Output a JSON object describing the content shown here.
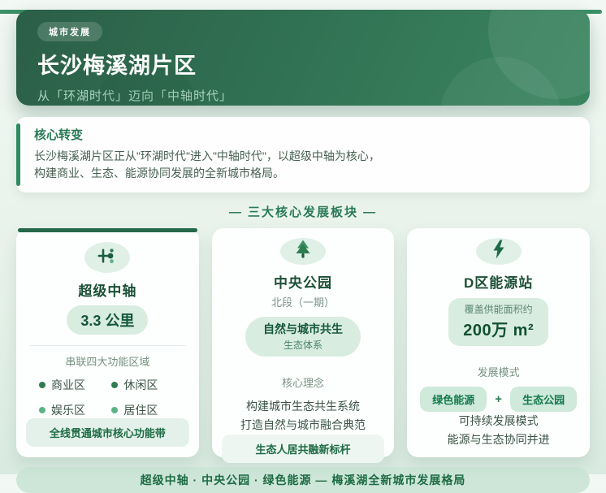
{
  "colors": {
    "accent_dark": "#1d5c40",
    "accent": "#2e7d52",
    "accent_light": "#5cb385",
    "header_gradient_start": "#2b5f47",
    "header_gradient_end": "#3a8560",
    "topbar": "#3c9168",
    "pill_bg": "#d9ece0",
    "footer_bg": "#cde6d8",
    "page_bg": "#e7f2ea"
  },
  "icons": {
    "card1": "axis-icon",
    "card2": "tree-icon",
    "card3": "bolt-icon"
  },
  "header": {
    "badge": "城市发展",
    "title": "长沙梅溪湖片区",
    "subtitle": "从「环湖时代」迈向「中轴时代」"
  },
  "transformation": {
    "title": "核心转变",
    "line1": "长沙梅溪湖片区正从\"环湖时代\"进入\"中轴时代\"，以超级中轴为核心，",
    "line2": "构建商业、生态、能源协同发展的全新城市格局。"
  },
  "section_heading": "— 三大核心发展板块 —",
  "cards": [
    {
      "title": "超级中轴",
      "stat": "3.3 公里",
      "label": "串联四大功能区域",
      "zones": [
        {
          "name": "商业区",
          "dot": "dark"
        },
        {
          "name": "休闲区",
          "dot": "dark"
        },
        {
          "name": "娱乐区",
          "dot": "light"
        },
        {
          "name": "居住区",
          "dot": "light"
        }
      ],
      "footer": "全线贯通城市核心功能带"
    },
    {
      "title": "中央公园",
      "subtitle": "北段（一期）",
      "pill_line1": "自然与城市共生",
      "pill_line2": "生态体系",
      "label": "核心理念",
      "line1": "构建城市生态共生系统",
      "line2": "打造自然与城市融合典范",
      "footer": "生态人居共融新标杆"
    },
    {
      "title": "D区能源站",
      "pill_line1": "覆盖供能面积约",
      "pill_line2": "200万 m²",
      "label": "发展模式",
      "tag1": "绿色能源",
      "plus": "+",
      "tag2": "生态公园",
      "line1": "可持续发展模式",
      "line2": "能源与生态协同并进"
    }
  ],
  "footer": {
    "text": "超级中轴 · 中央公园 · 绿色能源 — 梅溪湖全新城市发展格局"
  }
}
